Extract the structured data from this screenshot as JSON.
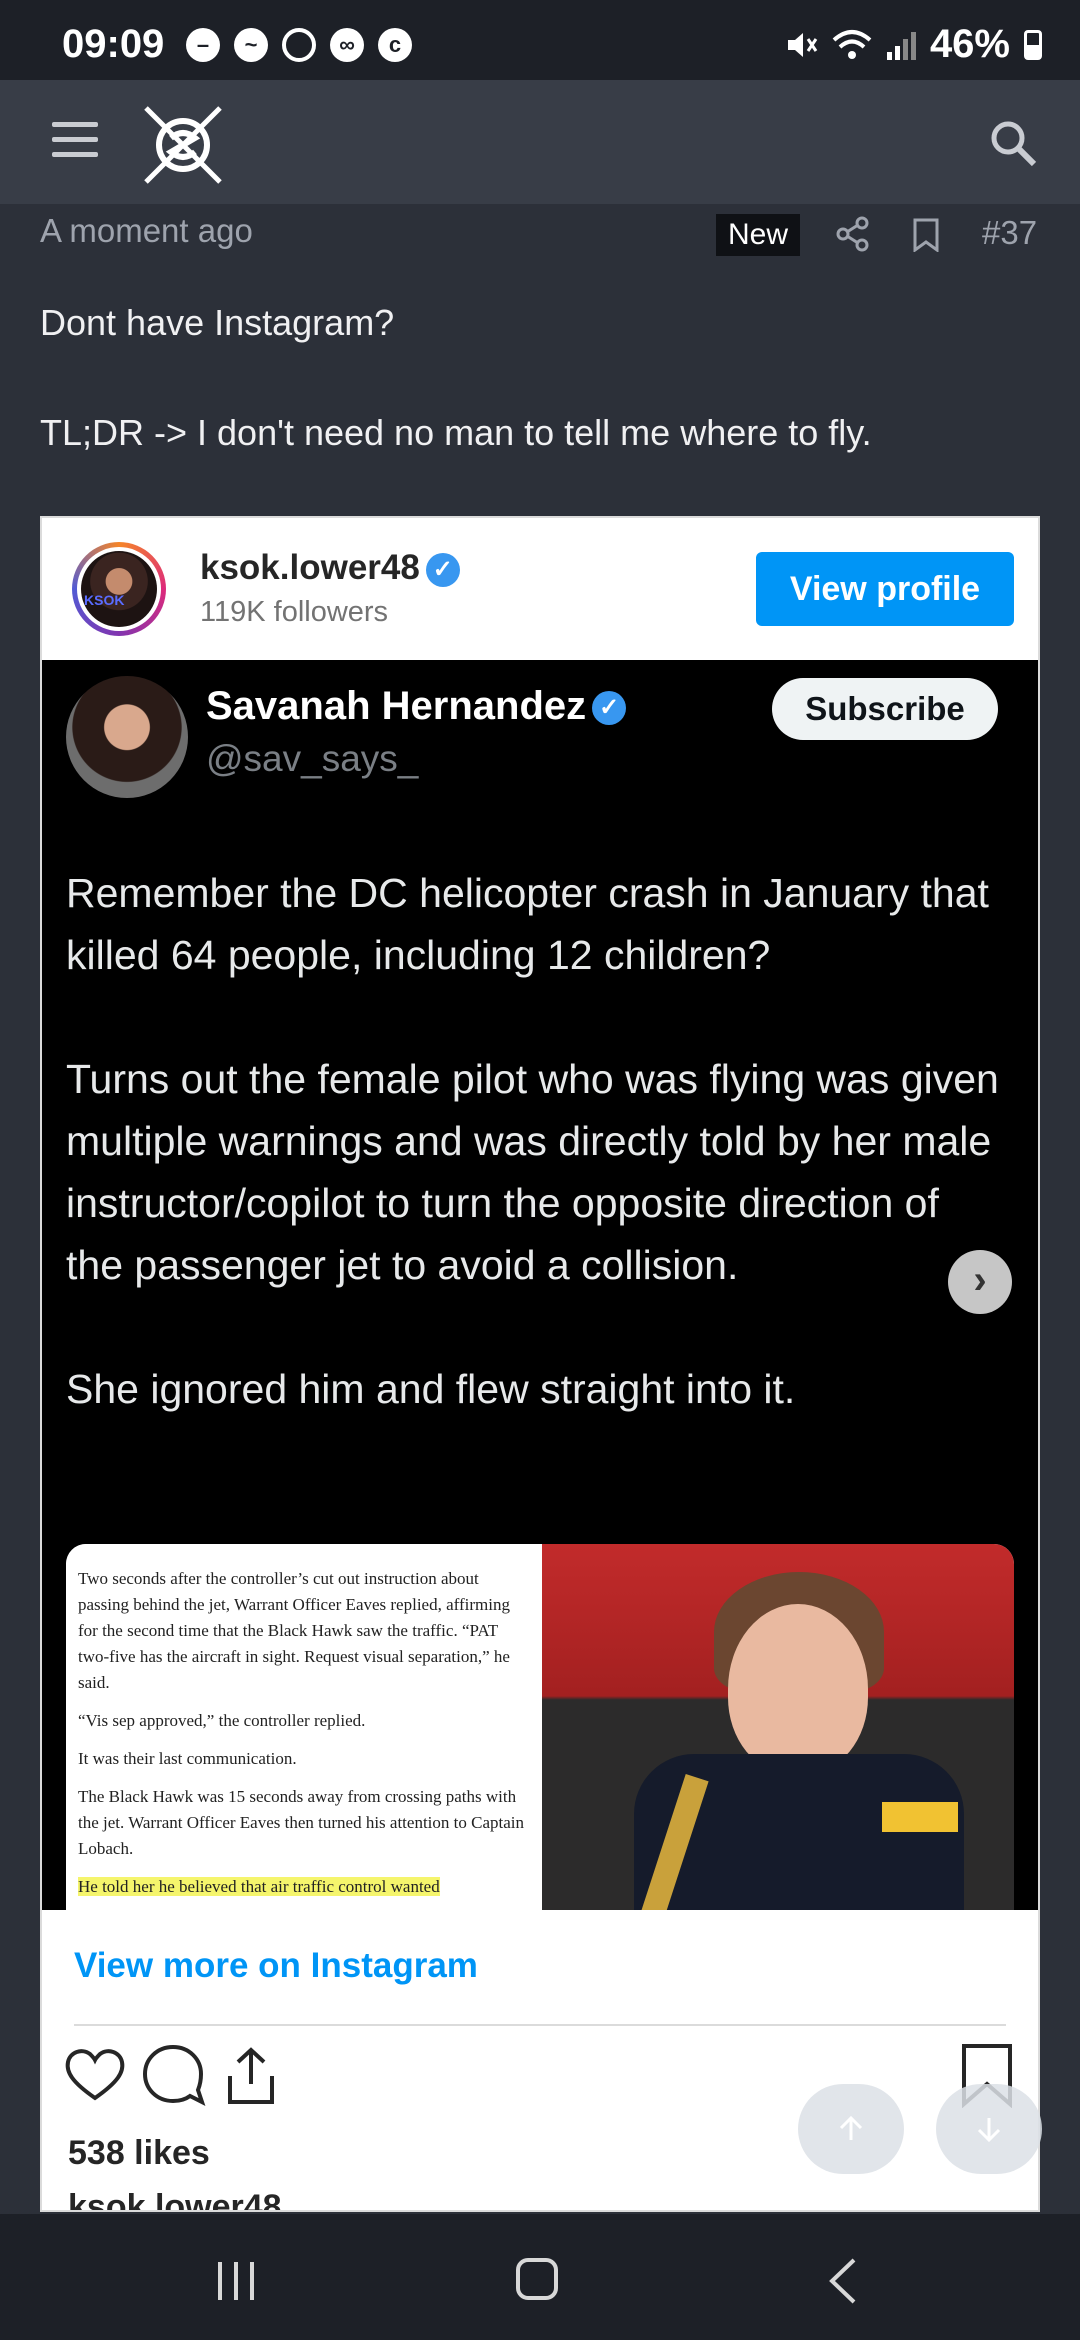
{
  "status_bar": {
    "time": "09:09",
    "battery": "46%",
    "battery_level": 0.46
  },
  "post": {
    "time": "A moment ago",
    "badge": "New",
    "number": "#37",
    "line1": "Dont have Instagram?",
    "line2": "TL;DR -> I don't need no man to tell me where to fly."
  },
  "embed": {
    "username": "ksok.lower48",
    "avatar_text": "KSOK",
    "followers": "119K followers",
    "view_profile": "View profile",
    "tweet": {
      "name": "Savanah Hernandez",
      "handle": "@sav_says_",
      "subscribe": "Subscribe",
      "p1": "Remember the DC helicopter crash in January that killed 64 people, including 12 children?",
      "p2": "Turns out the female pilot who was flying was given multiple warnings and was directly told by her male instructor/copilot to turn the opposite direction of the passenger jet to avoid a collision.",
      "p3": "She ignored him and flew straight into it."
    },
    "article": {
      "a1": "Two seconds after the controller’s cut out instruction about passing behind the jet, Warrant Officer Eaves replied, affirming for the second time that the Black Hawk saw the traffic. “PAT two-five has the aircraft in sight. Request visual separation,” he said.",
      "a2": "“Vis sep approved,” the controller replied.",
      "a3": "It was their last communication.",
      "a4": "The Black Hawk was 15 seconds away from crossing paths with the jet. Warrant Officer Eaves then turned his attention to Captain Lobach.",
      "a5": "He told her he believed that air traffic control wanted"
    },
    "view_more": "View more on Instagram",
    "likes": "538 likes",
    "caption_user": "ksok.lower48"
  },
  "icons": [
    "menu-icon",
    "search-icon",
    "share-icon",
    "bookmark-icon",
    "heart-icon",
    "comment-icon",
    "share-upload-icon",
    "save-icon",
    "verified-icon",
    "chevron-right-icon",
    "arrow-up-icon",
    "arrow-down-icon",
    "recent-apps-icon",
    "home-icon",
    "back-icon"
  ],
  "colors": {
    "background": "#2c3039",
    "header": "#383d47",
    "instagram_blue": "#0095f6"
  }
}
